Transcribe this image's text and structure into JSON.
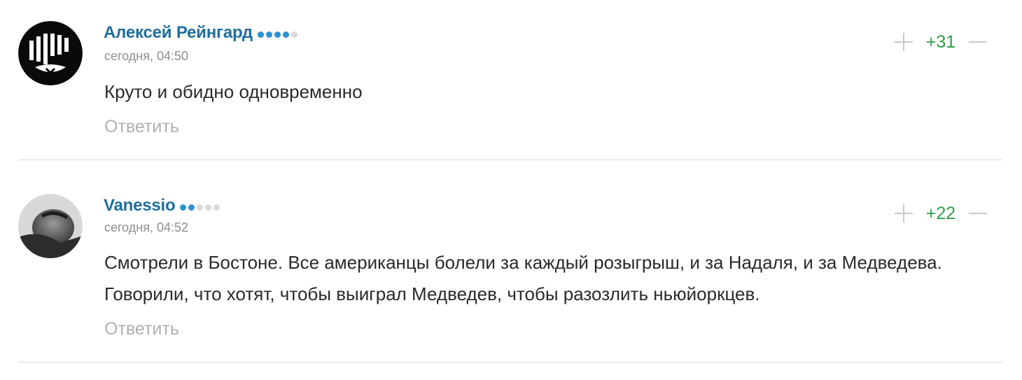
{
  "comments": [
    {
      "author": "Алексей Рейнгард",
      "rating_dots": 4,
      "rating_max": 5,
      "time": "сегодня, 04:50",
      "text": "Круто и обидно одновременно",
      "reply_label": "Ответить",
      "score": "+31"
    },
    {
      "author": "Vanessio",
      "rating_dots": 2,
      "rating_max": 5,
      "time": "сегодня, 04:52",
      "text": "Смотрели в Бостоне. Все американцы болели за каждый розыгрыш, и за Надаля, и за Медведева. Говорили, что хотят, чтобы выиграл Медведев, чтобы разозлить ньюйоркцев.",
      "reply_label": "Ответить",
      "score": "+22"
    }
  ],
  "colors": {
    "author": "#1f6e9e",
    "rating_on": "#2a93d5",
    "rating_off": "#d9d9d9",
    "score_positive": "#2fa046"
  }
}
